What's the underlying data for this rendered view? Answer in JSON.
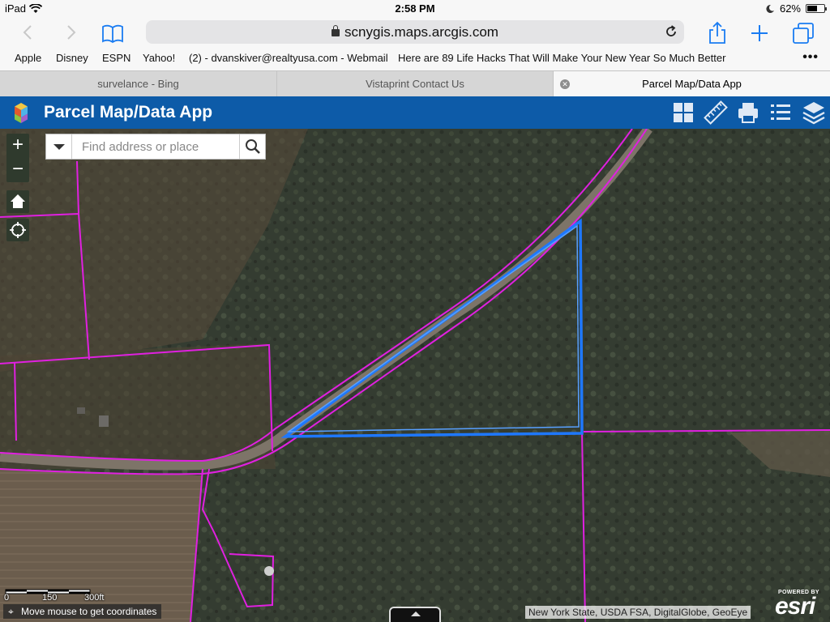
{
  "status": {
    "device": "iPad",
    "time": "2:58 PM",
    "battery": "62%",
    "battery_level": 0.62
  },
  "browser": {
    "url": "scnygis.maps.arcgis.com",
    "bookmarks": [
      "Apple",
      "Disney",
      "ESPN",
      "Yahoo!",
      "(2) - dvanskiver@realtyusa.com - Webmail",
      "Here are 89 Life Hacks That Will Make Your New Year So Much Better"
    ],
    "tabs": [
      {
        "title": "survelance - Bing",
        "active": false
      },
      {
        "title": "Vistaprint Contact Us",
        "active": false
      },
      {
        "title": "Parcel Map/Data App",
        "active": true
      }
    ]
  },
  "app": {
    "title": "Parcel Map/Data App",
    "header_icons": [
      "basemap-gallery-icon",
      "measure-ruler-icon",
      "print-icon",
      "legend-list-icon",
      "layers-icon"
    ],
    "header_color": "#0d5ba8"
  },
  "map": {
    "search_placeholder": "Find address or place",
    "scale_labels": [
      "0",
      "150",
      "300ft"
    ],
    "coordinates_text": "Move mouse to get coordinates",
    "attribution": "New York State, USDA FSA, DigitalGlobe, GeoEye",
    "powered_by": "POWERED BY",
    "esri_logo": "esri",
    "colors": {
      "parcel_line": "#e020e0",
      "selected_parcel": "#1e78ff",
      "imagery_forest": "#2f3a2d"
    }
  }
}
